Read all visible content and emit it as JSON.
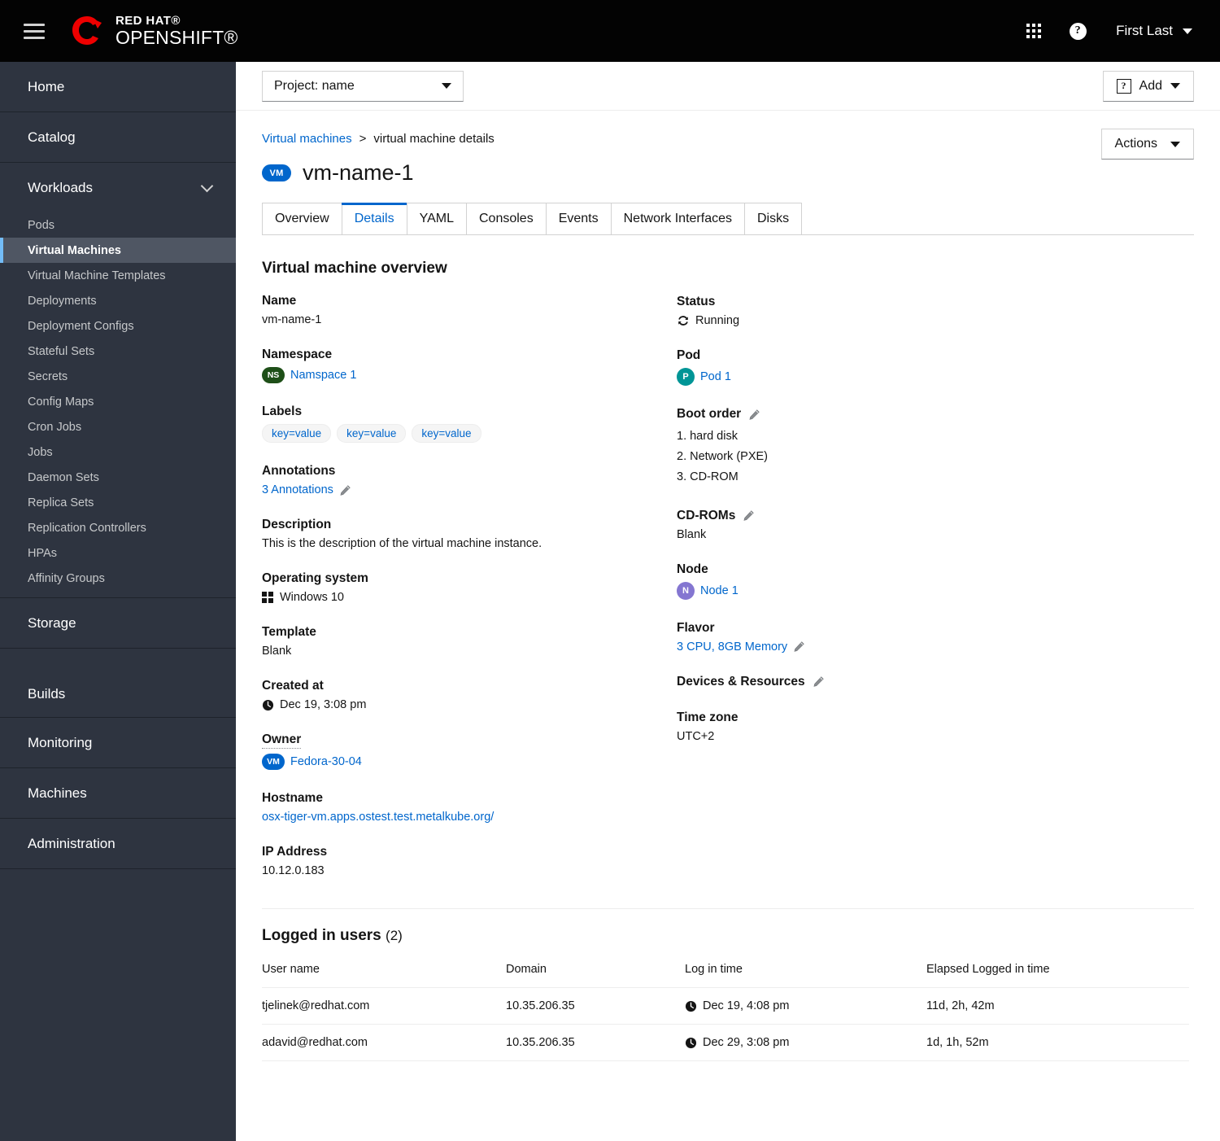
{
  "masthead": {
    "menu_icon": "hamburger-icon",
    "brand_line1": "RED HAT®",
    "brand_line2": "OPENSHIFT®",
    "apps_icon": "grid-apps-icon",
    "help_icon": "help-question-icon",
    "help_glyph": "?",
    "user_name": "First Last"
  },
  "toolbar": {
    "project_label": "Project: name",
    "add_label": "Add",
    "add_icon_glyph": "?"
  },
  "breadcrumb": {
    "parent": "Virtual machines",
    "separator": ">",
    "current": "virtual machine details"
  },
  "page": {
    "badge": "VM",
    "title": "vm-name-1",
    "actions_label": "Actions"
  },
  "tabs": [
    {
      "label": "Overview",
      "active": false
    },
    {
      "label": "Details",
      "active": true
    },
    {
      "label": "YAML",
      "active": false
    },
    {
      "label": "Consoles",
      "active": false
    },
    {
      "label": "Events",
      "active": false
    },
    {
      "label": "Network Interfaces",
      "active": false
    },
    {
      "label": "Disks",
      "active": false
    }
  ],
  "sidebar": {
    "items": [
      {
        "label": "Home"
      },
      {
        "label": "Catalog"
      }
    ],
    "workloads": {
      "label": "Workloads",
      "children": [
        {
          "label": "Pods",
          "active": false
        },
        {
          "label": "Virtual Machines",
          "active": true
        },
        {
          "label": "Virtual Machine Templates",
          "active": false
        },
        {
          "label": "Deployments",
          "active": false
        },
        {
          "label": "Deployment Configs",
          "active": false
        },
        {
          "label": "Stateful Sets",
          "active": false
        },
        {
          "label": "Secrets",
          "active": false
        },
        {
          "label": "Config Maps",
          "active": false
        },
        {
          "label": "Cron Jobs",
          "active": false
        },
        {
          "label": "Jobs",
          "active": false
        },
        {
          "label": "Daemon Sets",
          "active": false
        },
        {
          "label": "Replica Sets",
          "active": false
        },
        {
          "label": "Replication Controllers",
          "active": false
        },
        {
          "label": "HPAs",
          "active": false
        },
        {
          "label": "Affinity Groups",
          "active": false
        }
      ]
    },
    "bottom_items": [
      {
        "label": "Storage"
      },
      {
        "label": "Builds"
      },
      {
        "label": "Monitoring"
      },
      {
        "label": "Machines"
      },
      {
        "label": "Administration"
      }
    ]
  },
  "overview": {
    "section_title": "Virtual machine overview",
    "left": {
      "name_label": "Name",
      "name_value": "vm-name-1",
      "namespace_label": "Namespace",
      "namespace_badge": "NS",
      "namespace_value": "Namspace 1",
      "labels_label": "Labels",
      "labels": [
        "key=value",
        "key=value",
        "key=value"
      ],
      "annotations_label": "Annotations",
      "annotations_value": "3 Annotations",
      "description_label": "Description",
      "description_value": "This is the description of the virtual machine instance.",
      "os_label": "Operating system",
      "os_value": "Windows 10",
      "template_label": "Template",
      "template_value": "Blank",
      "created_label": "Created at",
      "created_value": "Dec 19, 3:08 pm",
      "owner_label": "Owner",
      "owner_badge": "VM",
      "owner_value": "Fedora-30-04",
      "hostname_label": "Hostname",
      "hostname_value": "osx-tiger-vm.apps.ostest.test.metalkube.org/",
      "ip_label": "IP Address",
      "ip_value": "10.12.0.183"
    },
    "right": {
      "status_label": "Status",
      "status_value": "Running",
      "pod_label": "Pod",
      "pod_badge": "P",
      "pod_value": "Pod 1",
      "boot_order_label": "Boot order",
      "boot_order": [
        "1. hard disk",
        "2. Network (PXE)",
        "3. CD-ROM"
      ],
      "cdroms_label": "CD-ROMs",
      "cdroms_value": "Blank",
      "node_label": "Node",
      "node_badge": "N",
      "node_value": "Node 1",
      "flavor_label": "Flavor",
      "flavor_value": "3 CPU, 8GB Memory",
      "devices_label": "Devices & Resources",
      "timezone_label": "Time zone",
      "timezone_value": "UTC+2"
    }
  },
  "logged_in_users": {
    "title": "Logged in users",
    "count": "(2)",
    "columns": [
      "User name",
      "Domain",
      "Log in time",
      "Elapsed Logged in time"
    ],
    "rows": [
      {
        "user": "tjelinek@redhat.com",
        "domain": "10.35.206.35",
        "login_time": "Dec 19, 4:08 pm",
        "elapsed": "11d, 2h, 42m"
      },
      {
        "user": "adavid@redhat.com",
        "domain": "10.35.206.35",
        "login_time": "Dec 29, 3:08 pm",
        "elapsed": "1d, 1h, 52m"
      }
    ]
  },
  "colors": {
    "brand_red": "#e00",
    "accent_blue": "#06c",
    "badge_vm": "#0066cc",
    "badge_ns": "#1e4f18",
    "badge_pod": "#009596",
    "badge_node": "#8476d1",
    "sidebar_bg": "#2e3440",
    "sidebar_active": "#4f5663",
    "active_bar": "#73bcf7"
  }
}
